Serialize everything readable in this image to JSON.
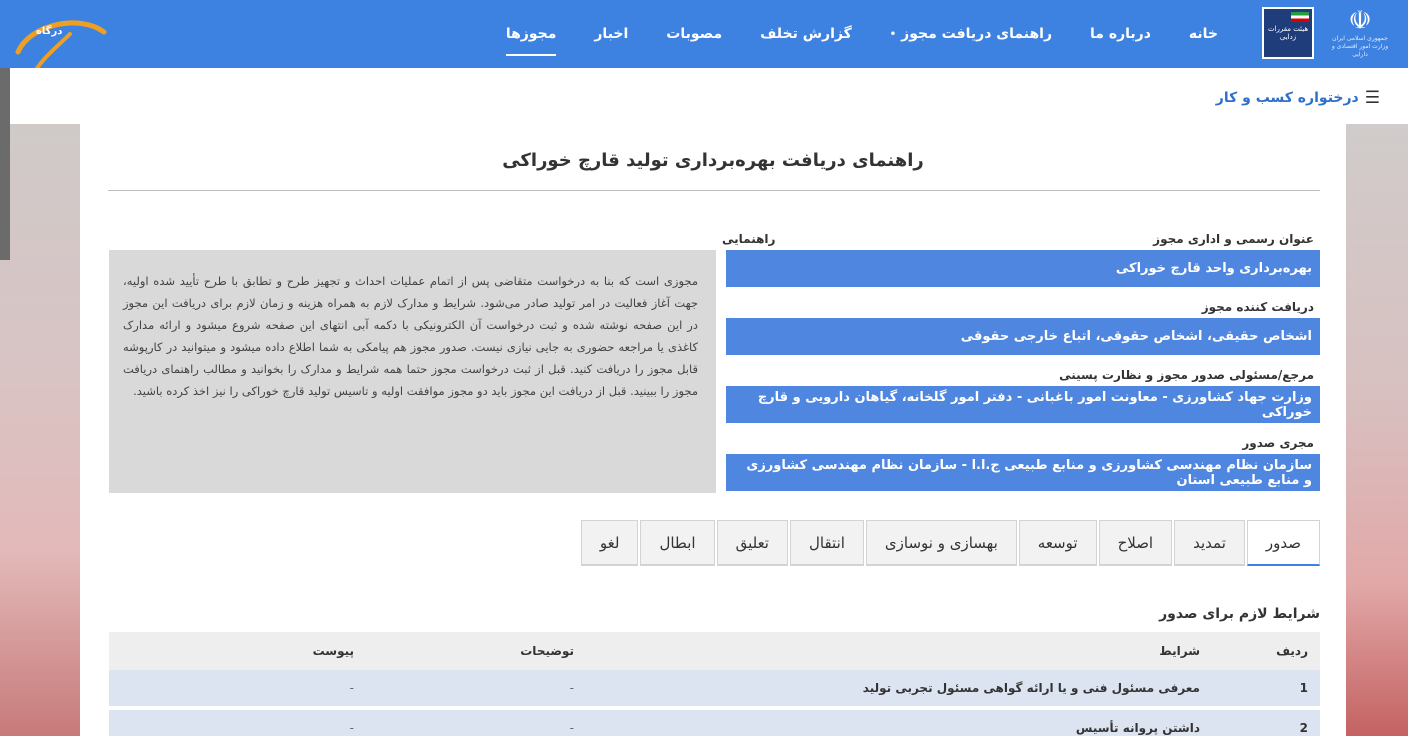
{
  "nav": {
    "items": [
      {
        "label": "خانه",
        "active": false
      },
      {
        "label": "درباره ما",
        "active": false
      },
      {
        "label": "راهنمای دریافت مجوز",
        "active": false,
        "dropdown": true
      },
      {
        "label": "گزارش تخلف",
        "active": false
      },
      {
        "label": "مصوبات",
        "active": false
      },
      {
        "label": "اخبار",
        "active": false
      },
      {
        "label": "مجوزها",
        "active": true
      }
    ],
    "emblem_caption": "جمهوری اسلامی ایران وزارت امور اقتصادی و دارایی",
    "box_logo_text": "هیئت مقررات زدایی",
    "corner_label": "درگاه"
  },
  "breadcrumb": {
    "label": "درختواره کسب و کار"
  },
  "page": {
    "title": "راهنمای دریافت بهره‌برداری تولید قارچ خوراکی",
    "fields": [
      {
        "label": "عنوان رسمی و اداری مجوز",
        "value": "بهره‌برداری واحد قارچ خوراکی"
      },
      {
        "label": "دریافت کننده مجوز",
        "value": "اشخاص حقیقی، اشخاص حقوقی، اتباع خارجی حقوقی"
      },
      {
        "label": "مرجع/مسئولی صدور مجوز و نظارت پسینی",
        "value": "وزارت جهاد کشاورزی - معاونت امور باغبانی - دفتر امور گلخانه، گیاهان دارویی و قارچ خوراکی"
      },
      {
        "label": "مجری صدور",
        "value": "سازمان نظام مهندسی کشاورزی و منابع طبیعی ج.ا.ا - سازمان نظام مهندسی کشاورزی و منابع طبیعی استان"
      }
    ],
    "guide_label": "راهنمایی",
    "guide_text": "مجوزی است که بنا به درخواست متقاضی پس از اتمام عملیات احداث و تجهیز طرح و تطابق با طرح تأیید شده اولیه، جهت آغاز فعالیت در امر تولید صادر می‌شود. شرایط و مدارک لازم به همراه هزینه و زمان لازم برای دریافت این مجوز در این صفحه نوشته شده و ثبت درخواست آن الکترونیکی با دکمه آبی انتهای این صفحه شروع میشود و ارائه مدارک کاغذی یا مراجعه حضوری به جایی نیازی نیست. صدور مجوز هم پیامکی به شما اطلاع داده میشود و میتوانید در کارپوشه قابل مجوز را دریافت کنید. قبل از ثبت درخواست مجوز حتما همه شرایط و مدارک را بخوانید و مطالب راهنمای دریافت مجوز را ببینید. قبل از دریافت این مجوز باید دو مجوز موافقت اولیه و تاسیس تولید قارچ خوراکی را نیز اخذ کرده باشید.",
    "tabs": [
      {
        "label": "صدور",
        "active": true
      },
      {
        "label": "تمدید",
        "active": false
      },
      {
        "label": "اصلاح",
        "active": false
      },
      {
        "label": "توسعه",
        "active": false
      },
      {
        "label": "بهسازی و نوسازی",
        "active": false
      },
      {
        "label": "انتقال",
        "active": false
      },
      {
        "label": "تعلیق",
        "active": false
      },
      {
        "label": "ابطال",
        "active": false
      },
      {
        "label": "لغو",
        "active": false
      }
    ],
    "conditions_title": "شرایط لازم برای صدور",
    "table": {
      "headers": [
        "ردیف",
        "شرایط",
        "توضیحات",
        "پیوست"
      ],
      "rows": [
        [
          "1",
          "معرفی مسئول فنی و یا ارائه گواهی مسئول تجربی تولید",
          "-",
          "-"
        ],
        [
          "2",
          "داشتن پروانه تأسیس",
          "-",
          "-"
        ]
      ]
    }
  },
  "colors": {
    "nav": "#3d82e0",
    "field": "#4f86e0",
    "accent": "#2f6fcc"
  }
}
